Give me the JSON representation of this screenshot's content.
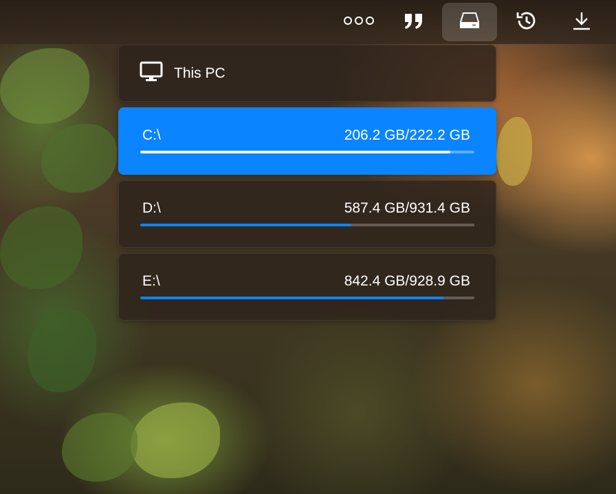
{
  "toolbar": {
    "buttons": [
      {
        "icon": "more-icon",
        "active": false
      },
      {
        "icon": "quote-icon",
        "active": false
      },
      {
        "icon": "drive-icon",
        "active": true
      },
      {
        "icon": "history-icon",
        "active": false
      },
      {
        "icon": "download-icon",
        "active": false
      }
    ]
  },
  "drives_panel": {
    "header": {
      "icon": "monitor-icon",
      "title": "This PC"
    },
    "drives": [
      {
        "letter": "C:\\",
        "usage": "206.2 GB/222.2 GB",
        "used_fraction": 0.928,
        "selected": true
      },
      {
        "letter": "D:\\",
        "usage": "587.4 GB/931.4 GB",
        "used_fraction": 0.631,
        "selected": false
      },
      {
        "letter": "E:\\",
        "usage": "842.4 GB/928.9 GB",
        "used_fraction": 0.907,
        "selected": false
      }
    ]
  },
  "colors": {
    "accent": "#0a84ff",
    "progress_track": "#5a5048",
    "text": "#ffffff"
  }
}
